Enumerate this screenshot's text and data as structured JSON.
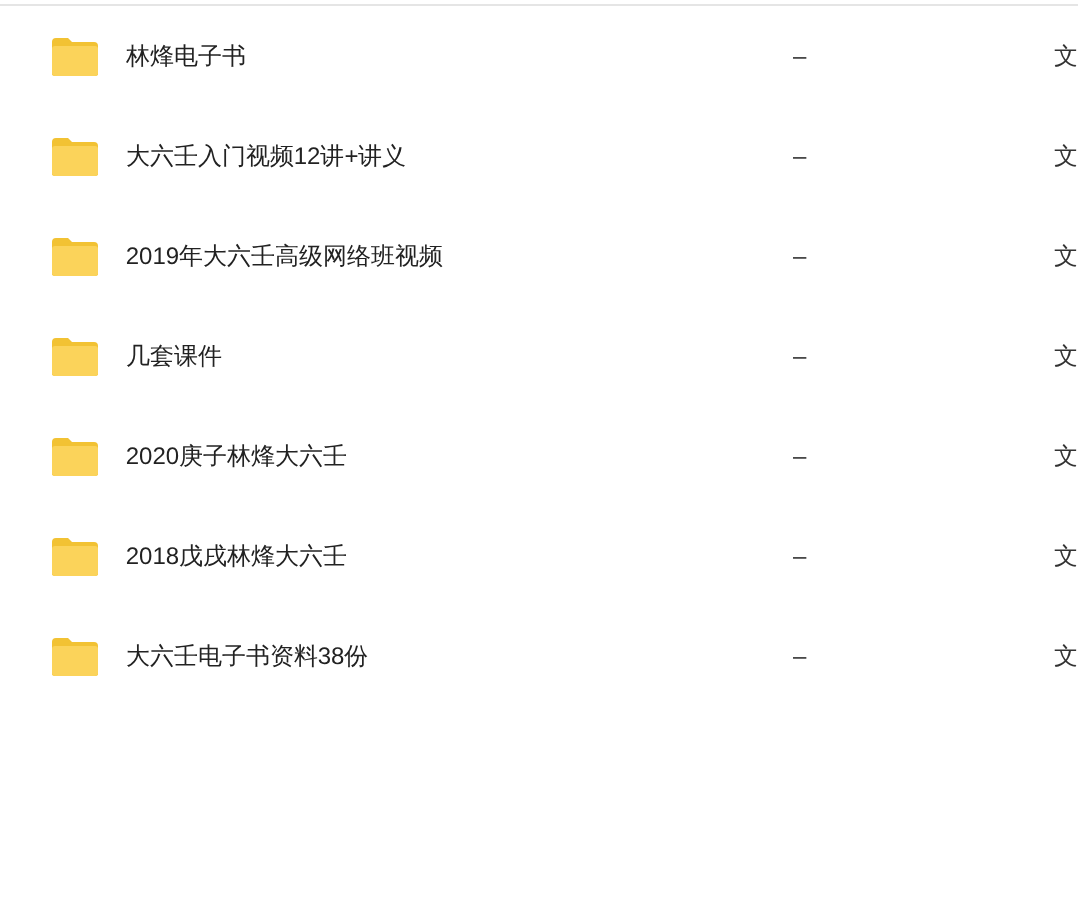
{
  "files": [
    {
      "name": "林烽电子书",
      "size": "–",
      "kind": "文"
    },
    {
      "name": "大六壬入门视频12讲+讲义",
      "size": "–",
      "kind": "文"
    },
    {
      "name": "2019年大六壬高级网络班视频",
      "size": "–",
      "kind": "文"
    },
    {
      "name": "几套课件",
      "size": "–",
      "kind": "文"
    },
    {
      "name": "2020庚子林烽大六壬",
      "size": "–",
      "kind": "文"
    },
    {
      "name": "2018戊戌林烽大六壬",
      "size": "–",
      "kind": "文"
    },
    {
      "name": "大六壬电子书资料38份",
      "size": "–",
      "kind": "文"
    }
  ]
}
